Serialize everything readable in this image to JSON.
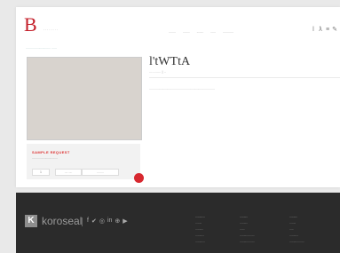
{
  "header": {
    "logo": "B",
    "logo_text": "........",
    "nav": [
      "........",
      "........",
      "........",
      "......",
      "............"
    ],
    "tools": [
      "ⅼ",
      "ƛ",
      "≡",
      "✎"
    ]
  },
  "breadcrumb": "............................. ......",
  "product": {
    "title": "l'tWTtA",
    "code": "............  |  ..",
    "description": "............................................................................"
  },
  "sample": {
    "title": "SAMPLE REQUEST",
    "subtitle": "..............................",
    "qty": "1",
    "size": ".... ....",
    "color": "........"
  },
  "footer": {
    "k": "K",
    "brand": "koroseal",
    "social": [
      "f",
      "✔",
      "◎",
      "in",
      "⊕",
      "▶"
    ],
    "cols": [
      [
        "............",
        "........",
        "..........",
        "...........",
        "............"
      ],
      [
        "..........",
        "..........",
        "......",
        "..................",
        ".................."
      ],
      [
        "..........",
        "........",
        ".....",
        "...........",
        ".................."
      ]
    ],
    "colors": {
      "background": "#2b2b2b",
      "accent": "#d7282f"
    }
  }
}
